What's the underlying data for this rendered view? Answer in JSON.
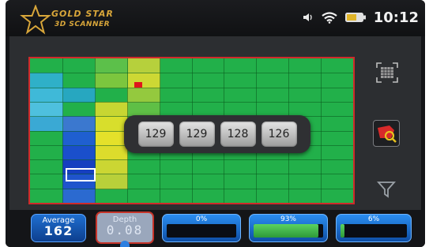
{
  "logo": {
    "line1": "GOLD STAR",
    "line2": "3D SCANNER"
  },
  "status": {
    "volume_icon": "speaker-icon",
    "wifi_icon": "wifi-icon",
    "battery_icon": "battery-icon",
    "time": "10:12"
  },
  "readouts": [
    "129",
    "129",
    "128",
    "126"
  ],
  "sidebar": {
    "icons": [
      "grid-view-icon",
      "scan-analysis-icon",
      "filter-icon"
    ]
  },
  "bottom": {
    "average": {
      "label": "Average",
      "value": "162"
    },
    "depth": {
      "label": "Depth",
      "value": "0.08"
    },
    "meters": [
      {
        "label": "0%",
        "level": 0
      },
      {
        "label": "93%",
        "level": 0.93
      },
      {
        "label": "6%",
        "level": 0.06
      }
    ]
  },
  "colors": {
    "field_green": "#22b04a",
    "cursor_border": "#ffffff",
    "frame_red": "#d02a2a",
    "accent_blue": "#1f6fd0"
  }
}
